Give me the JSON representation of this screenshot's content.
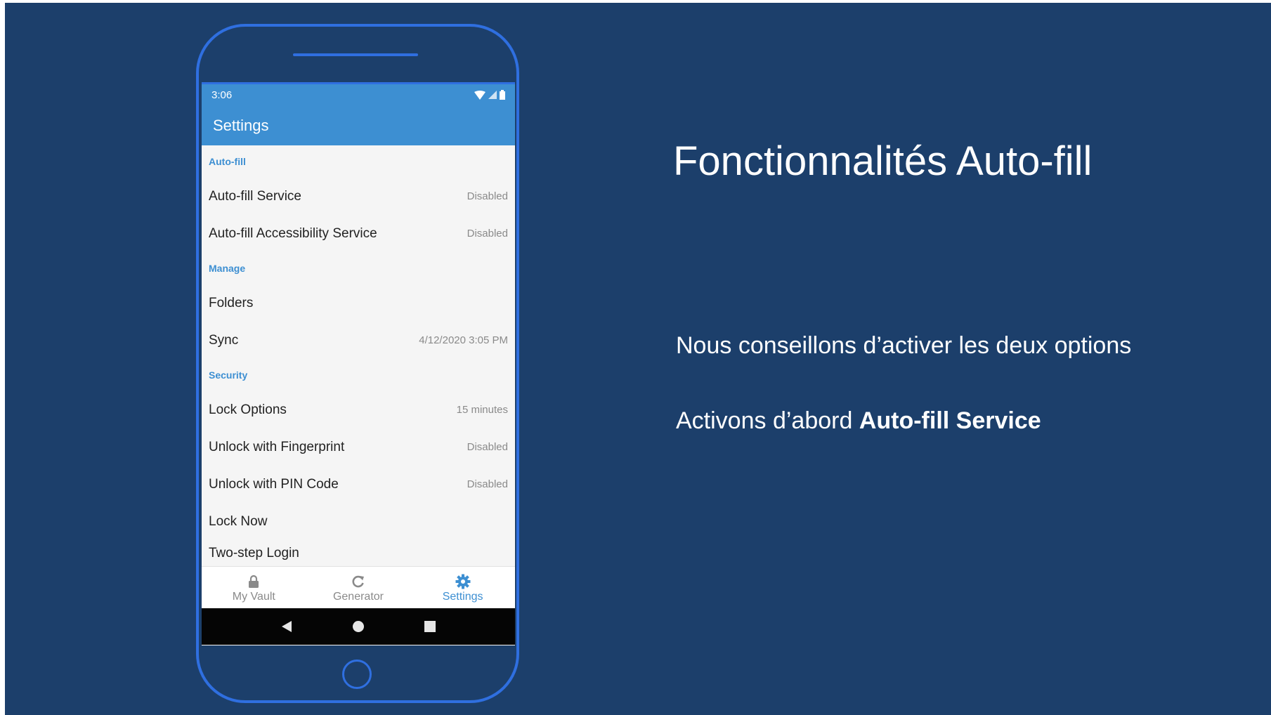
{
  "slide": {
    "title": "Fonctionnalités Auto-fill",
    "line1": "Nous conseillons d’activer les deux options",
    "line2_prefix": "Activons d’abord ",
    "line2_bold": "Auto-fill Service",
    "background_color": "#1c3f6b",
    "phone_outline_color": "#2f6fe0"
  },
  "phone": {
    "status_time": "3:06",
    "status_icons": [
      "wifi-icon",
      "signal-icon",
      "battery-icon"
    ],
    "appbar_title": "Settings",
    "accent_color": "#3d8fd2",
    "sections": {
      "autofill": {
        "header": "Auto-fill",
        "items": [
          {
            "label": "Auto-fill Service",
            "value": "Disabled"
          },
          {
            "label": "Auto-fill Accessibility Service",
            "value": "Disabled"
          }
        ]
      },
      "manage": {
        "header": "Manage",
        "items": [
          {
            "label": "Folders",
            "value": ""
          },
          {
            "label": "Sync",
            "value": "4/12/2020 3:05 PM"
          }
        ]
      },
      "security": {
        "header": "Security",
        "items": [
          {
            "label": "Lock Options",
            "value": "15 minutes"
          },
          {
            "label": "Unlock with Fingerprint",
            "value": "Disabled"
          },
          {
            "label": "Unlock with PIN Code",
            "value": "Disabled"
          },
          {
            "label": "Lock Now",
            "value": ""
          },
          {
            "label": "Two-step Login",
            "value": ""
          }
        ]
      }
    },
    "tabs": [
      {
        "label": "My Vault",
        "icon": "lock-icon",
        "active": false
      },
      {
        "label": "Generator",
        "icon": "refresh-icon",
        "active": false
      },
      {
        "label": "Settings",
        "icon": "gear-icon",
        "active": true
      }
    ],
    "nav_buttons": [
      "back-icon",
      "home-icon",
      "recents-icon"
    ]
  }
}
